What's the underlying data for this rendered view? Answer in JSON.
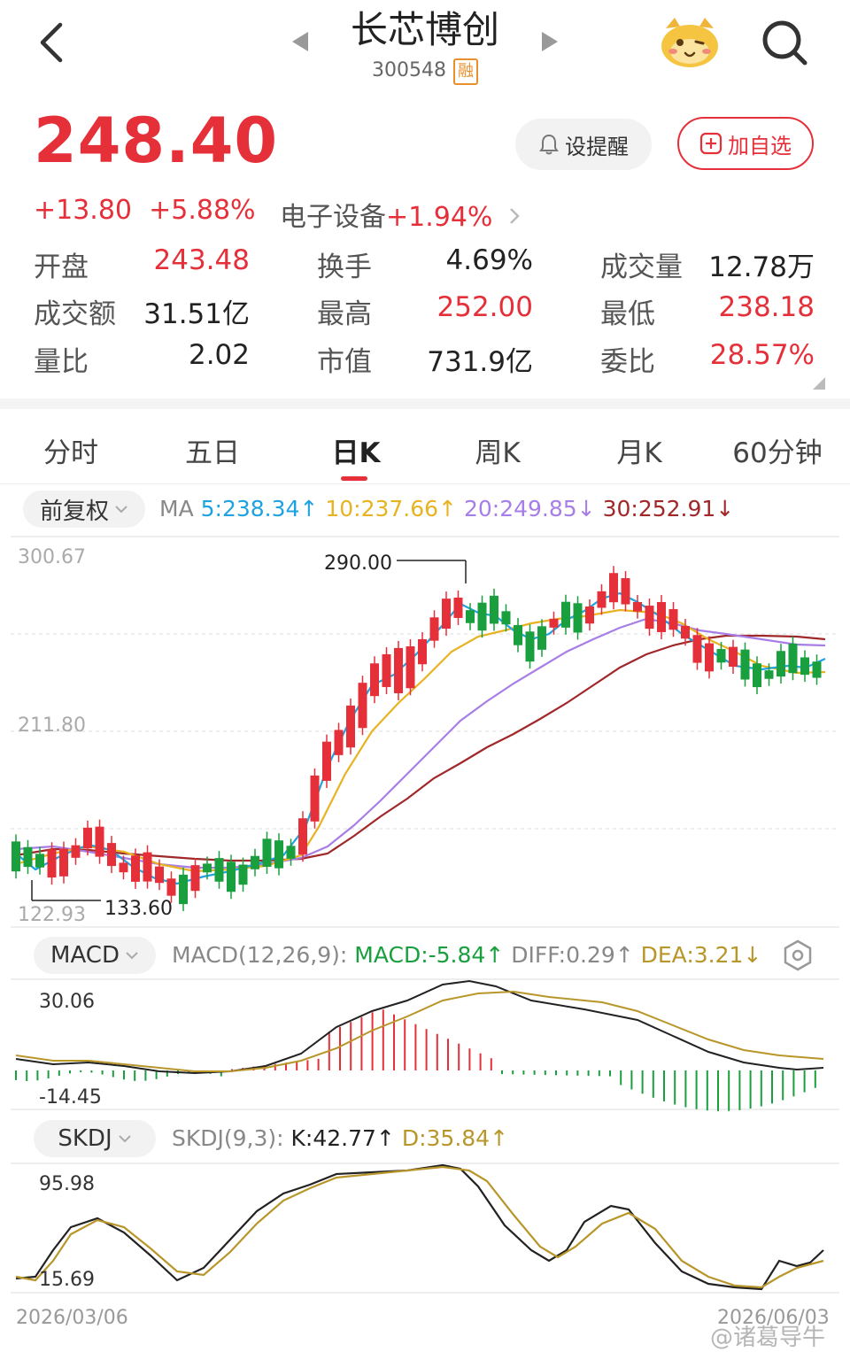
{
  "header": {
    "title": "长芯博创",
    "code": "300548",
    "margin_badge": "融"
  },
  "quote": {
    "price": "248.40",
    "change": "+13.80",
    "change_pct": "+5.88%",
    "sector_name": "电子设备",
    "sector_change": "+1.94%",
    "alarm_label": "设提醒",
    "watch_label": "加自选",
    "stats": [
      {
        "label": "开盘",
        "value": "243.48",
        "color": "red"
      },
      {
        "label": "换手",
        "value": "4.69%",
        "color": "black"
      },
      {
        "label": "成交量",
        "value": "12.78万",
        "color": "black"
      },
      {
        "label": "成交额",
        "value": "31.51亿",
        "color": "black"
      },
      {
        "label": "最高",
        "value": "252.00",
        "color": "red"
      },
      {
        "label": "最低",
        "value": "238.18",
        "color": "red"
      },
      {
        "label": "量比",
        "value": "2.02",
        "color": "black"
      },
      {
        "label": "市值",
        "value": "731.9亿",
        "color": "black"
      },
      {
        "label": "委比",
        "value": "28.57%",
        "color": "red"
      }
    ]
  },
  "tabs": [
    "分时",
    "五日",
    "日K",
    "周K",
    "月K",
    "60分钟"
  ],
  "active_tab": "日K",
  "ma_bar": {
    "adjust": "前复权",
    "label": "MA",
    "ma5": "5:238.34↑",
    "ma10": "10:237.66↑",
    "ma20": "20:249.85↓",
    "ma30": "30:252.91↓"
  },
  "kline": {
    "y_high": "300.67",
    "y_mid": "211.80",
    "y_low": "122.93",
    "peak_label": "290.00",
    "trough_label": "133.60"
  },
  "macd": {
    "selector": "MACD",
    "params": "MACD(12,26,9):",
    "macd": "MACD:-5.84↑",
    "diff": "DIFF:0.29↑",
    "dea": "DEA:3.21↓",
    "y_high": "30.06",
    "y_low": "-14.45"
  },
  "skdj": {
    "selector": "SKDJ",
    "params": "SKDJ(9,3):",
    "k": "K:42.77↑",
    "d": "D:35.84↑",
    "y_high": "95.98",
    "y_low": "15.69"
  },
  "dates": {
    "start": "2026/03/06",
    "end": "2026/06/03"
  },
  "watermark": "@诸葛导牛",
  "colors": {
    "up": "#e5303a",
    "down": "#1a9f3e",
    "ma5": "#1fa3e0",
    "ma10": "#e8b321",
    "ma20": "#a77ee6",
    "ma30": "#a0282a"
  }
}
